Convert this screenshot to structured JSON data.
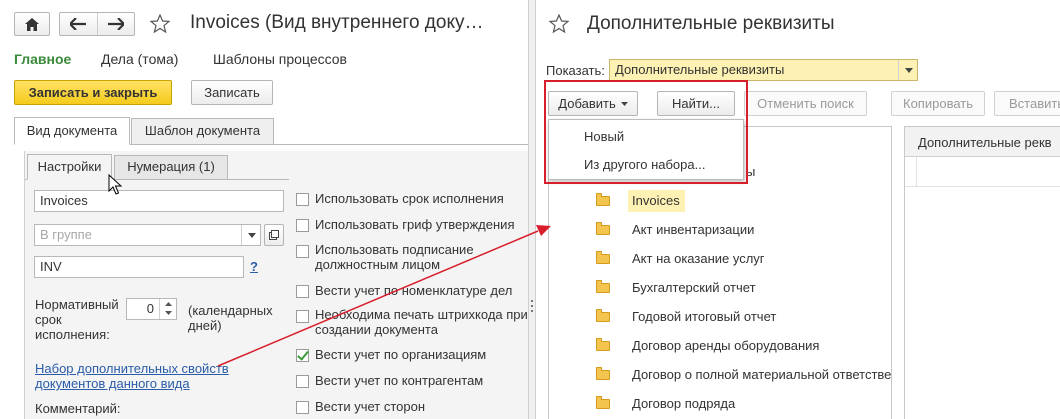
{
  "left_window": {
    "title": "Invoices (Вид внутреннего доку…",
    "nav": [
      "Главное",
      "Дела (тома)",
      "Шаблоны процессов"
    ],
    "buttons": {
      "save_close": "Записать и закрыть",
      "save": "Записать"
    },
    "tabs": [
      "Вид документа",
      "Шаблон документа"
    ],
    "subtabs": [
      "Настройки",
      "Нумерация (1)"
    ],
    "name_value": "Invoices",
    "group_placeholder": "В группе",
    "code_value": "INV",
    "help_mark": "?",
    "term_label": [
      "Нормативный",
      "срок",
      "исполнения:"
    ],
    "term_value": "0",
    "term_unit": [
      "(календарных",
      "дней)"
    ],
    "link_text": [
      "Набор дополнительных свойств",
      "документов данного вида"
    ],
    "comment_label": "Комментарий:",
    "checkboxes": [
      {
        "label": [
          "Использовать срок исполнения"
        ],
        "checked": false
      },
      {
        "label": [
          "Использовать гриф утверждения"
        ],
        "checked": false
      },
      {
        "label": [
          "Использовать подписание",
          "должностным лицом"
        ],
        "checked": false
      },
      {
        "label": [
          "Вести учет по номенклатуре дел"
        ],
        "checked": false
      },
      {
        "label": [
          "Необходима печать штрихкода при",
          "создании документа"
        ],
        "checked": false
      },
      {
        "label": [
          "Вести учет по организациям"
        ],
        "checked": true
      },
      {
        "label": [
          "Вести учет по контрагентам"
        ],
        "checked": false
      },
      {
        "label": [
          "Вести учет сторон"
        ],
        "checked": false
      }
    ]
  },
  "right_window": {
    "title": "Дополнительные реквизиты",
    "show_label": "Показать:",
    "show_value": "Дополнительные реквизиты",
    "toolbar": {
      "add": "Добавить",
      "find": "Найти...",
      "cancel_search": "Отменить поиск",
      "copy": "Копировать",
      "paste": "Вставить"
    },
    "dropdown": [
      "Новый",
      "Из другого набора..."
    ],
    "tree_partial": "ы",
    "tree_items": [
      "Invoices",
      "Акт инвентаризации",
      "Акт на оказание услуг",
      "Бухгалтерский отчет",
      "Годовой итоговый отчет",
      "Договор аренды оборудования",
      "Договор о полной материальной ответстве",
      "Договор подряда"
    ],
    "right_column_header": "Дополнительные рекв"
  },
  "colors": {
    "accent_green": "#3a8a3a",
    "highlight_red": "#d81e2a",
    "selected_yellow": "#fdf2b3",
    "yellow_button": "#f5cb1d"
  }
}
